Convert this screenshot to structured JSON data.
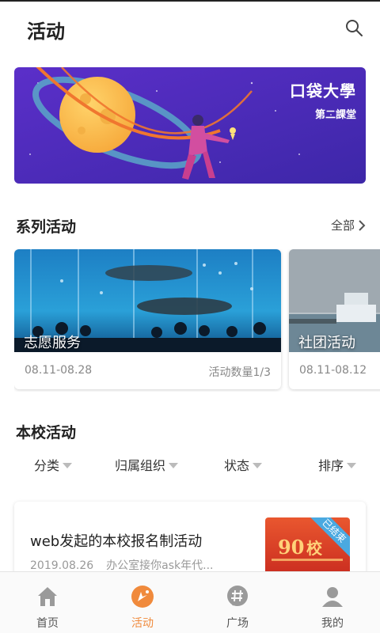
{
  "header": {
    "title": "活动"
  },
  "banner": {
    "brand_title": "口袋大學",
    "brand_subtitle": "第二課堂"
  },
  "series_section": {
    "title": "系列活动",
    "more_label": "全部"
  },
  "series_cards": [
    {
      "caption": "志愿服务",
      "date_range": "08.11-08.28",
      "count": "活动数量1/3"
    },
    {
      "caption": "社团活动",
      "date_range": "08.11-08.12"
    }
  ],
  "school_section": {
    "title": "本校活动"
  },
  "filters": [
    {
      "label": "分类"
    },
    {
      "label": "归属组织"
    },
    {
      "label": "状态"
    },
    {
      "label": "排序"
    }
  ],
  "activity": {
    "title": "web发起的本校报名制活动",
    "date": "2019.08.26",
    "organizer": "办公室接你ask年代...",
    "thumb_number": "90",
    "thumb_text": "校",
    "status_badge": "已结束"
  },
  "tabs": [
    {
      "label": "首页",
      "icon": "home-icon"
    },
    {
      "label": "活动",
      "icon": "activity-icon",
      "active": true
    },
    {
      "label": "广场",
      "icon": "hashtag-icon"
    },
    {
      "label": "我的",
      "icon": "user-icon"
    }
  ],
  "colors": {
    "accent": "#f08a3c",
    "banner_bg": "#4b2bb8"
  }
}
